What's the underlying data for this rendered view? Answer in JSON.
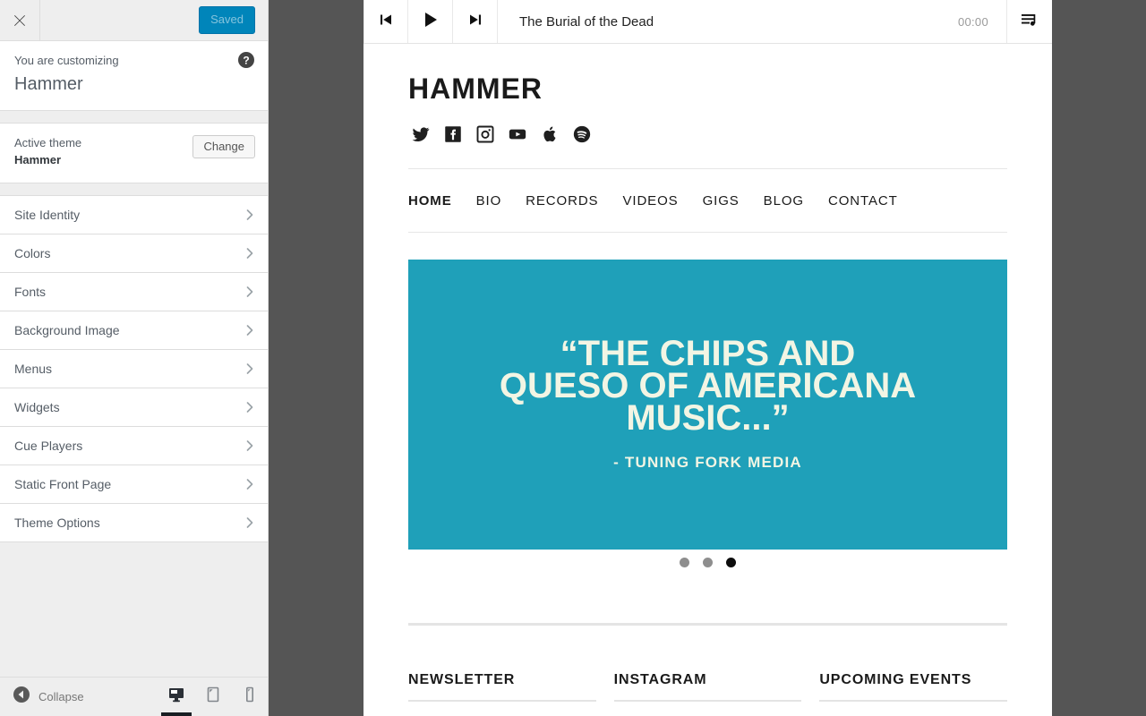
{
  "customizer": {
    "close_icon": "close-x-icon",
    "save_button": "Saved",
    "help_icon": "help-circle-icon",
    "info": {
      "label": "You are customizing",
      "title": "Hammer"
    },
    "active_theme": {
      "label": "Active theme",
      "name": "Hammer",
      "change_button": "Change"
    },
    "panels": [
      {
        "label": "Site Identity"
      },
      {
        "label": "Colors"
      },
      {
        "label": "Fonts"
      },
      {
        "label": "Background Image"
      },
      {
        "label": "Menus"
      },
      {
        "label": "Widgets"
      },
      {
        "label": "Cue Players"
      },
      {
        "label": "Static Front Page"
      },
      {
        "label": "Theme Options"
      }
    ],
    "footer": {
      "collapse_label": "Collapse",
      "collapse_icon": "collapse-left-arrow-icon",
      "devices": [
        {
          "name": "desktop",
          "icon": "desktop-icon",
          "active": true
        },
        {
          "name": "tablet",
          "icon": "tablet-icon",
          "active": false
        },
        {
          "name": "mobile",
          "icon": "mobile-icon",
          "active": false
        }
      ]
    },
    "colors": {
      "save_button_bg": "#0085ba",
      "panel_bg": "#eeeeee",
      "row_bg": "#ffffff",
      "border": "#dddddd",
      "text": "#555d66"
    }
  },
  "preview": {
    "player": {
      "prev_icon": "skip-previous-icon",
      "play_icon": "play-icon",
      "next_icon": "skip-next-icon",
      "track_title": "The Burial of the Dead",
      "time": "00:00",
      "playlist_icon": "playlist-icon"
    },
    "site": {
      "title": "HAMMER",
      "social": [
        {
          "name": "twitter",
          "icon": "twitter-icon"
        },
        {
          "name": "facebook",
          "icon": "facebook-icon"
        },
        {
          "name": "instagram",
          "icon": "instagram-icon"
        },
        {
          "name": "youtube",
          "icon": "youtube-icon"
        },
        {
          "name": "apple-music",
          "icon": "apple-icon"
        },
        {
          "name": "spotify",
          "icon": "spotify-icon"
        }
      ],
      "nav": [
        {
          "label": "HOME",
          "active": true
        },
        {
          "label": "BIO",
          "active": false
        },
        {
          "label": "RECORDS",
          "active": false
        },
        {
          "label": "VIDEOS",
          "active": false
        },
        {
          "label": "GIGS",
          "active": false
        },
        {
          "label": "BLOG",
          "active": false
        },
        {
          "label": "CONTACT",
          "active": false
        }
      ],
      "hero": {
        "quote": "“THE CHIPS AND QUESO OF AMERICANA MUSIC...”",
        "attribution": "- TUNING FORK MEDIA",
        "background_color": "#1fa0b9",
        "text_color": "#f2f5e4",
        "slides": [
          {
            "active": false
          },
          {
            "active": false
          },
          {
            "active": true
          }
        ]
      },
      "widgets": [
        {
          "title": "NEWSLETTER"
        },
        {
          "title": "INSTAGRAM"
        },
        {
          "title": "UPCOMING EVENTS"
        }
      ]
    }
  }
}
